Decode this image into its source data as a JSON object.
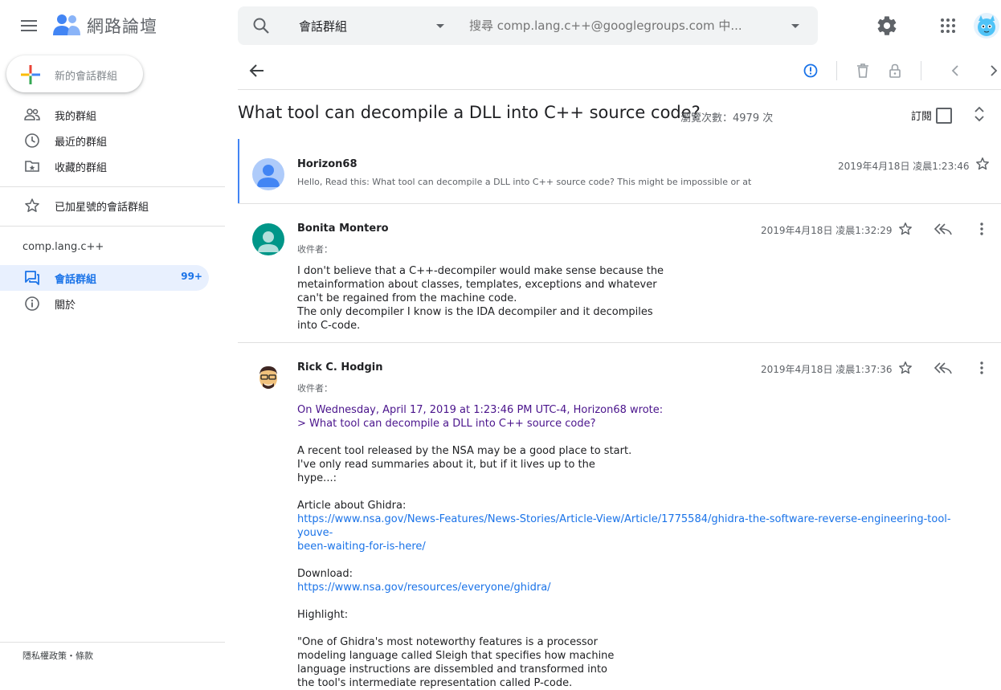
{
  "header": {
    "app_title": "網路論壇",
    "search_scope": "會話群組",
    "search_placeholder": "搜尋 comp.lang.c++@googlegroups.com 中..."
  },
  "sidebar": {
    "new_conversation": "新的會話群組",
    "items": [
      {
        "label": "我的群組",
        "icon": "people-icon"
      },
      {
        "label": "最近的群組",
        "icon": "clock-icon"
      },
      {
        "label": "收藏的群組",
        "icon": "folder-star-icon"
      },
      {
        "label": "已加星號的會話群組",
        "icon": "star-icon"
      }
    ],
    "group_name": "comp.lang.c++",
    "group_items": [
      {
        "label": "會話群組",
        "count": "99+",
        "icon": "conversation-icon",
        "active": true
      },
      {
        "label": "關於",
        "icon": "info-icon"
      }
    ],
    "footer": "隱私權政策・條款"
  },
  "thread": {
    "title": "What tool can decompile a DLL into C++ source code?",
    "views": "瀏覽次數：4979 次",
    "subscribe_label": "訂閱"
  },
  "messages": [
    {
      "author": "Horizon68",
      "date": "2019年4月18日 凌晨1:23:46",
      "snippet": "Hello, Read this: What tool can decompile a DLL into C++ source code? This might be impossible or at"
    },
    {
      "author": "Bonita Montero",
      "date": "2019年4月18日 凌晨1:32:29",
      "to_label": "收件者：",
      "body": [
        "I don't believe that a C++-decompiler would make sense because the",
        "metainformation about classes, templates, exceptions and whatever",
        "can't be regained from the machine code.",
        "The only decompiler I know is the IDA decompiler and it decompiles",
        "into C-code."
      ]
    },
    {
      "author": "Rick C. Hodgin",
      "date": "2019年4月18日 凌晨1:37:36",
      "to_label": "收件者：",
      "quote": [
        "On Wednesday, April 17, 2019 at 1:23:46 PM UTC-4, Horizon68 wrote:",
        "> What tool can decompile a DLL into C++ source code?"
      ],
      "para1": [
        "A recent tool released by the NSA may be a good place to start.",
        "I've only read summaries about it, but if it lives up to the",
        "hype...:"
      ],
      "article_label": "Article about Ghidra:",
      "article_link_1": "https://www.nsa.gov/News-Features/News-Stories/Article-View/Article/1775584/ghidra-the-software-reverse-engineering-tool-youve-",
      "article_link_2": "been-waiting-for-is-here/",
      "download_label": "Download:",
      "download_link": "https://www.nsa.gov/resources/everyone/ghidra/",
      "highlight_label": "Highlight:",
      "highlight": [
        "\"One of Ghidra's most noteworthy features is a processor",
        "modeling language called Sleigh that specifies how machine",
        "language instructions are dissembled and transformed into",
        "the tool's intermediate representation called P-code."
      ]
    }
  ],
  "colors": {
    "accent": "#1a73e8",
    "active_bg": "#e8f0fe",
    "quote": "#4a148c"
  }
}
